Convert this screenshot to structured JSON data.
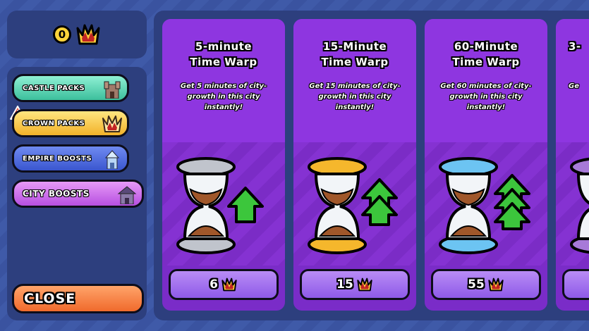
{
  "currency": {
    "amount": "0",
    "crown_icon": "crown-icon"
  },
  "nav": {
    "castle_packs": "CASTLE PACKS",
    "crown_packs": "CROWN PACKS",
    "empire_boosts": "EMPIRE BOOSTS",
    "city_boosts": "CITY BOOSTS",
    "close": "CLOSE"
  },
  "cards": [
    {
      "title_line1": "5-minute",
      "title_line2": "Time Warp",
      "desc": "Get 5 minutes of city-growth in this city instantly!",
      "price": "6",
      "color": "#c0c4cc",
      "arrow_count": 1
    },
    {
      "title_line1": "15-Minute",
      "title_line2": "Time Warp",
      "desc": "Get 15 minutes of city-growth in this city instantly!",
      "price": "15",
      "color": "#f5b72c",
      "arrow_count": 2
    },
    {
      "title_line1": "60-Minute",
      "title_line2": "Time Warp",
      "desc": "Get 60 minutes of city-growth in this city instantly!",
      "price": "55",
      "color": "#6cc4f2",
      "arrow_count": 3
    },
    {
      "title_line1": "3-",
      "title_line2": "",
      "desc": "Ge",
      "price": "",
      "color": "#a77ad8",
      "arrow_count": 0
    }
  ]
}
